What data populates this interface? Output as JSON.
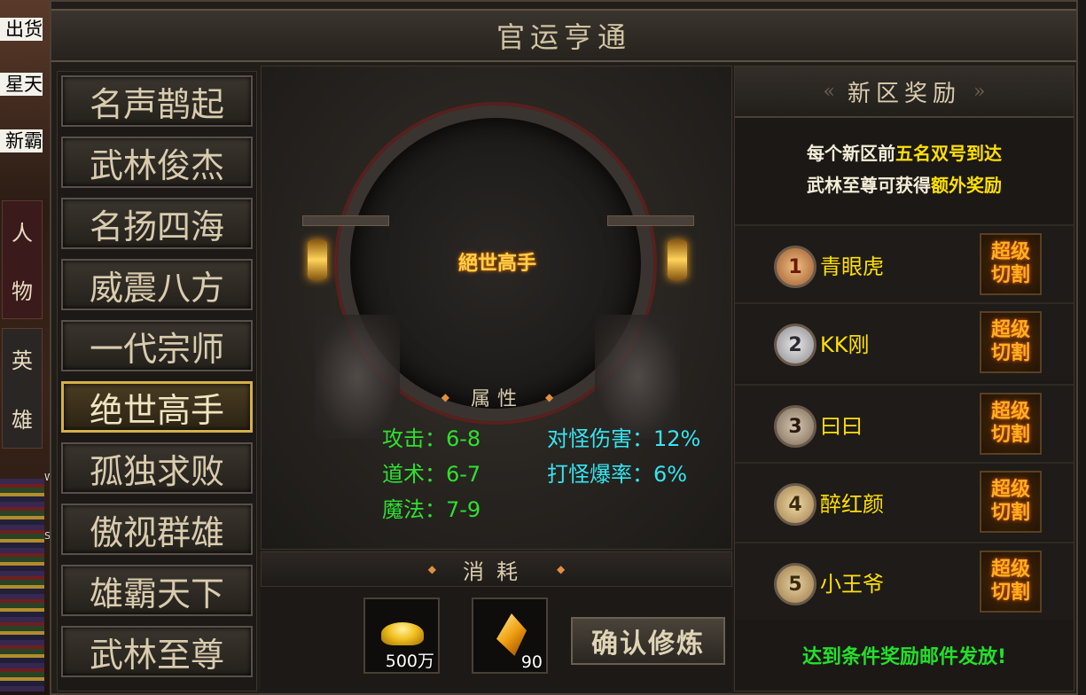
{
  "background": {
    "nameplates": [
      "出货",
      "星天",
      "新霸"
    ],
    "side_tabs": [
      {
        "chars": [
          "人",
          "物"
        ]
      },
      {
        "chars": [
          "英",
          "雄"
        ]
      }
    ],
    "minimap_letters": [
      "W",
      "D",
      "S"
    ]
  },
  "window": {
    "title": "官运亨通"
  },
  "ranks": {
    "items": [
      "名声鹊起",
      "武林俊杰",
      "名扬四海",
      "威震八方",
      "一代宗师",
      "绝世高手",
      "孤独求败",
      "傲视群雄",
      "雄霸天下",
      "武林至尊"
    ],
    "selected_index": 5
  },
  "emblem": {
    "title": "絕世高手"
  },
  "attributes": {
    "header": "属性",
    "rows": [
      {
        "label": "攻击：",
        "value": "6-8",
        "color": "#2fe02f"
      },
      {
        "label": "道术：",
        "value": "6-7",
        "color": "#2fe02f"
      },
      {
        "label": "魔法：",
        "value": "7-9",
        "color": "#2fe02f"
      },
      {
        "label": "对怪伤害：",
        "value": "12%",
        "color": "#36e4f0"
      },
      {
        "label": "打怪爆率：",
        "value": "6%",
        "color": "#36e4f0"
      }
    ]
  },
  "consume": {
    "header": "消耗",
    "items": [
      {
        "icon": "gold-ingot-icon",
        "count": "500万"
      },
      {
        "icon": "amber-crystal-icon",
        "count": "90"
      }
    ],
    "confirm_label": "确认修炼"
  },
  "reward": {
    "header": "新区奖励",
    "desc_line1_a": "每个新区前",
    "desc_line1_b": "五名双号到达",
    "desc_line2_a": "武林至尊可获得",
    "desc_line2_b": "额外奖励",
    "rows": [
      {
        "rank": "1",
        "name": "青眼虎",
        "badge_l1": "超级",
        "badge_l2": "切割"
      },
      {
        "rank": "2",
        "name": "KK刚",
        "badge_l1": "超级",
        "badge_l2": "切割"
      },
      {
        "rank": "3",
        "name": "曰曰",
        "badge_l1": "超级",
        "badge_l2": "切割"
      },
      {
        "rank": "4",
        "name": "醉红颜",
        "badge_l1": "超级",
        "badge_l2": "切割"
      },
      {
        "rank": "5",
        "name": "小王爷",
        "badge_l1": "超级",
        "badge_l2": "切割"
      }
    ],
    "footer": "达到条件奖励邮件发放!"
  },
  "colors": {
    "highlight_yellow": "#ffe000",
    "attr_green": "#2fe02f",
    "attr_cyan": "#36e4f0",
    "selected_border": "#d4b04a",
    "footer_green": "#22e02a"
  }
}
